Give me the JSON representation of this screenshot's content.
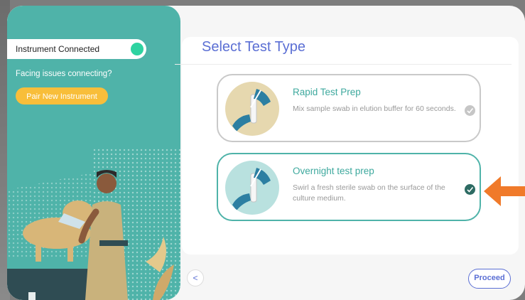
{
  "sidebar": {
    "status_label": "Instrument Connected",
    "issues_text": "Facing issues connecting?",
    "pair_button_label": "Pair New Instrument"
  },
  "main": {
    "title": "Select Test Type",
    "options": [
      {
        "title": "Rapid Test Prep",
        "description": "Mix sample swab in elution buffer for 60 seconds.",
        "selected": false
      },
      {
        "title": "Overnight test prep",
        "description": "Swirl a fresh sterile swab on the surface of the culture medium.",
        "selected": true
      }
    ]
  },
  "footer": {
    "back_icon": "<",
    "proceed_label": "Proceed"
  },
  "colors": {
    "teal": "#4fb3a9",
    "accent": "#5b6fd4",
    "pair_button": "#f8be3a",
    "connected_dot": "#2ed3a1",
    "arrow": "#f07a2a"
  }
}
